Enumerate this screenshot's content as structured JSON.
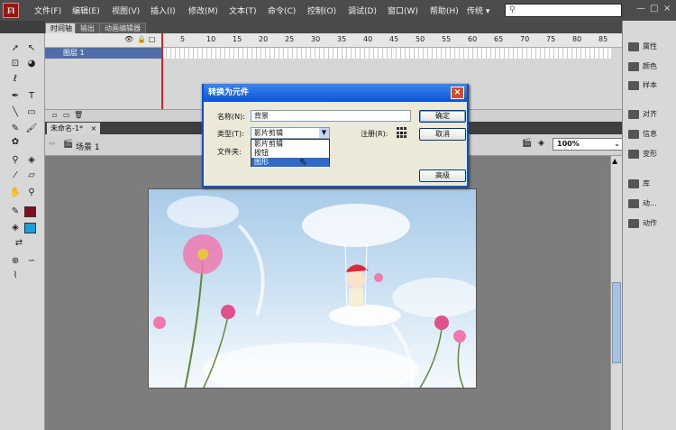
{
  "app": {
    "logo": "Fl"
  },
  "menu": [
    "文件(F)",
    "编辑(E)",
    "视图(V)",
    "插入(I)",
    "修改(M)",
    "文本(T)",
    "命令(C)",
    "控制(O)",
    "调试(D)",
    "窗口(W)",
    "帮助(H)"
  ],
  "workspace": "传统 ▾",
  "window_controls": {
    "minimize": "—",
    "restore": "□",
    "close": "×"
  },
  "timeline": {
    "tabs": [
      "时间轴",
      "输出",
      "动画编辑器"
    ],
    "frame_numbers": [
      "5",
      "10",
      "15",
      "20",
      "25",
      "30",
      "35",
      "40",
      "45",
      "50",
      "55",
      "60",
      "65",
      "70",
      "75",
      "80",
      "85"
    ],
    "layer_name": "图层 1"
  },
  "document": {
    "tab_title": "未命名-1*",
    "tab_close": "×",
    "scene_label": "场景 1",
    "zoom": "100%"
  },
  "dialog": {
    "title": "转换为元件",
    "name_label": "名称(N):",
    "name_value": "背景",
    "type_label": "类型(T):",
    "type_value": "影片剪辑",
    "type_options": [
      "影片剪辑",
      "按钮",
      "图形"
    ],
    "type_selected": "图形",
    "registration_label": "注册(R):",
    "folder_label": "文件夹:",
    "ok": "确定",
    "cancel": "取消",
    "advanced": "高级",
    "close": "×"
  },
  "right_panel": [
    "属性",
    "颜色",
    "样本",
    "对齐",
    "信息",
    "变形",
    "库",
    "动...",
    "动作"
  ],
  "colors": {
    "stroke": "#7a1020",
    "fill": "#1aa0d8",
    "dialog_title": "#0a53d6",
    "layer_selected": "#4f6ea7"
  }
}
